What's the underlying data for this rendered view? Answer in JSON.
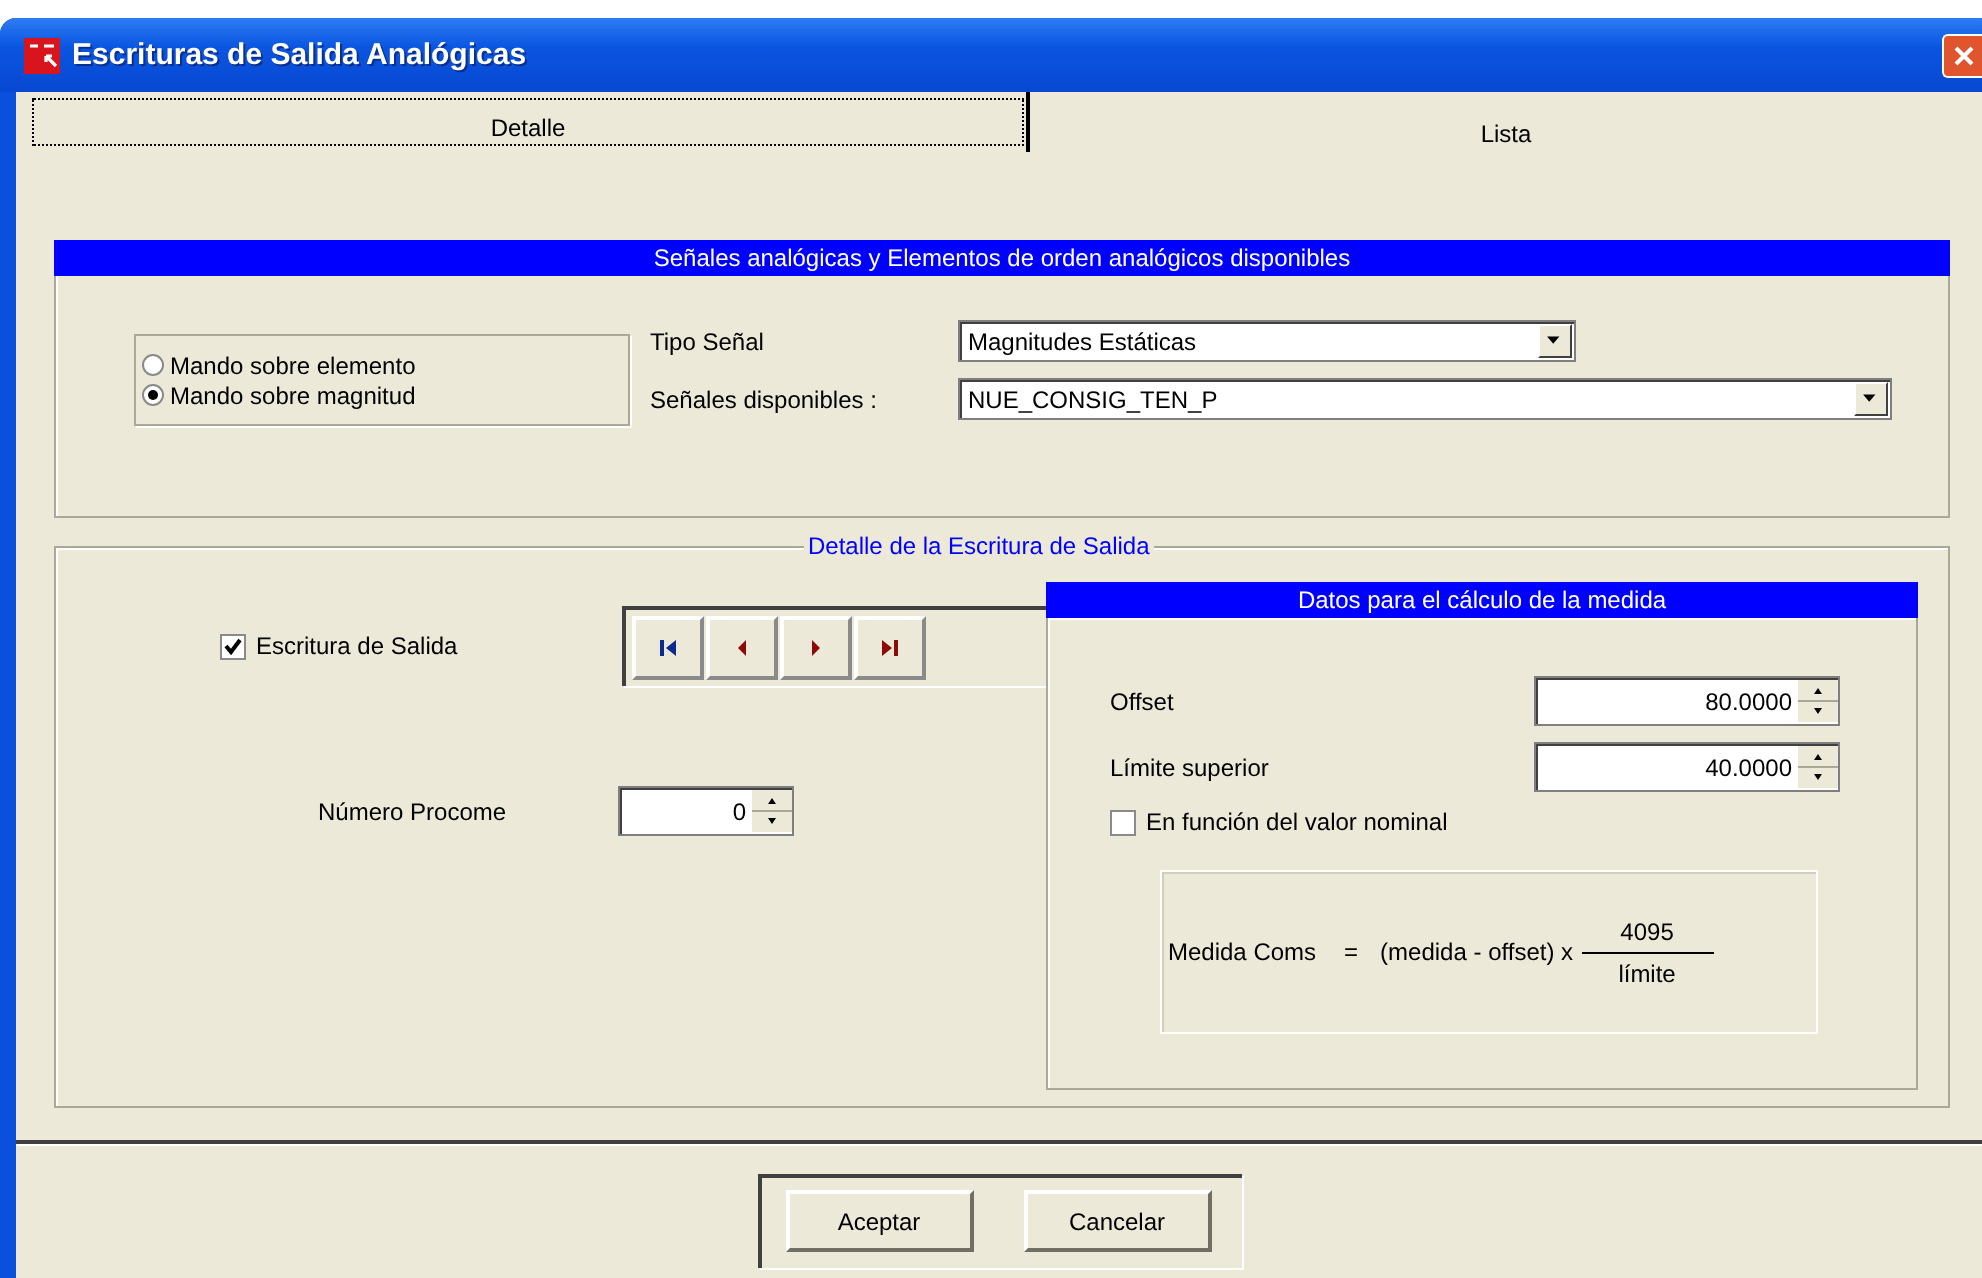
{
  "window": {
    "title": "Escrituras de Salida Analógicas"
  },
  "tabs": [
    {
      "label": "Detalle",
      "selected": true
    },
    {
      "label": "Lista",
      "selected": false
    }
  ],
  "signals_panel": {
    "title": "Señales analógicas y Elementos de orden analógicos disponibles",
    "modes": [
      {
        "label": "Mando sobre elemento",
        "selected": false
      },
      {
        "label": "Mando sobre magnitud",
        "selected": true
      }
    ],
    "signal_type": {
      "label": "Tipo Señal",
      "value": "Magnitudes Estáticas"
    },
    "available_signals": {
      "label": "Señales disponibles :",
      "value": "NUE_CONSIG_TEN_P"
    }
  },
  "output_detail": {
    "title": "Detalle de la Escritura de Salida",
    "output_write": {
      "label": "Escritura de Salida",
      "checked": true
    },
    "procome_number": {
      "label": "Número Procome",
      "value": "0"
    },
    "measure": {
      "title": "Datos para el cálculo de la medida",
      "offset": {
        "label": "Offset",
        "value": "80.0000"
      },
      "upper_limit": {
        "label": "Límite superior",
        "value": "40.0000"
      },
      "nominal": {
        "label": "En función del valor nominal",
        "checked": false
      },
      "formula": {
        "lhs": "Medida Coms",
        "equals": "=",
        "expression": "(medida - offset) x",
        "numerator": "4095",
        "denominator": "límite"
      }
    }
  },
  "buttons": [
    "Aceptar",
    "Cancelar"
  ]
}
